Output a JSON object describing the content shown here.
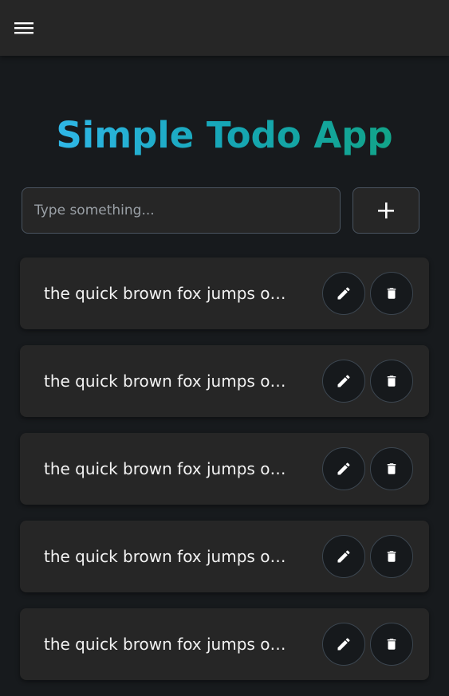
{
  "header": {
    "menu_icon": "hamburger-menu-icon"
  },
  "app": {
    "title": "Simple Todo App"
  },
  "new_todo": {
    "placeholder": "Type something...",
    "value": "",
    "add_icon": "plus-icon"
  },
  "todos": [
    {
      "text": "the quick brown fox jumps over the lazy dog",
      "edit_icon": "pencil-icon",
      "delete_icon": "trash-icon"
    },
    {
      "text": "the quick brown fox jumps over the lazy dog",
      "edit_icon": "pencil-icon",
      "delete_icon": "trash-icon"
    },
    {
      "text": "the quick brown fox jumps over the lazy dog",
      "edit_icon": "pencil-icon",
      "delete_icon": "trash-icon"
    },
    {
      "text": "the quick brown fox jumps over the lazy dog",
      "edit_icon": "pencil-icon",
      "delete_icon": "trash-icon"
    },
    {
      "text": "the quick brown fox jumps over the lazy dog",
      "edit_icon": "pencil-icon",
      "delete_icon": "trash-icon"
    }
  ],
  "colors": {
    "background": "#171a1d",
    "surface": "#262626",
    "title_gradient_start": "#38bdf8",
    "title_gradient_end": "#10a37a",
    "text": "#f2f2f2"
  }
}
